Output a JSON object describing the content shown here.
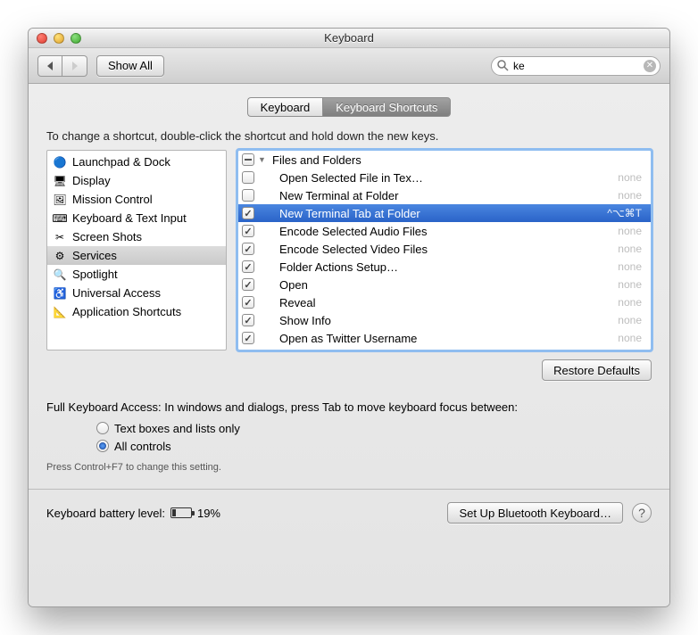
{
  "window": {
    "title": "Keyboard"
  },
  "toolbar": {
    "show_all": "Show All",
    "search_value": "ke"
  },
  "tabs": {
    "keyboard": "Keyboard",
    "shortcuts": "Keyboard Shortcuts"
  },
  "instructions": "To change a shortcut, double-click the shortcut and hold down the new keys.",
  "sidebar": {
    "items": [
      {
        "label": "Launchpad & Dock",
        "icon": "🔵",
        "selected": false
      },
      {
        "label": "Display",
        "icon": "🖥",
        "selected": false
      },
      {
        "label": "Mission Control",
        "icon": "🖼",
        "selected": false
      },
      {
        "label": "Keyboard & Text Input",
        "icon": "⌨",
        "selected": false
      },
      {
        "label": "Screen Shots",
        "icon": "✂",
        "selected": false
      },
      {
        "label": "Services",
        "icon": "⚙",
        "selected": true
      },
      {
        "label": "Spotlight",
        "icon": "🔍",
        "selected": false
      },
      {
        "label": "Universal Access",
        "icon": "♿",
        "selected": false
      },
      {
        "label": "Application Shortcuts",
        "icon": "📐",
        "selected": false
      }
    ]
  },
  "shortcuts": {
    "group": "Files and Folders",
    "rows": [
      {
        "checked": false,
        "label": "Open Selected File in Tex…",
        "key": "none",
        "selected": false
      },
      {
        "checked": false,
        "label": "New Terminal at Folder",
        "key": "none",
        "selected": false
      },
      {
        "checked": true,
        "label": "New Terminal Tab at Folder",
        "key": "^⌥⌘T",
        "selected": true
      },
      {
        "checked": true,
        "label": "Encode Selected Audio Files",
        "key": "none",
        "selected": false
      },
      {
        "checked": true,
        "label": "Encode Selected Video Files",
        "key": "none",
        "selected": false
      },
      {
        "checked": true,
        "label": "Folder Actions Setup…",
        "key": "none",
        "selected": false
      },
      {
        "checked": true,
        "label": "Open",
        "key": "none",
        "selected": false
      },
      {
        "checked": true,
        "label": "Reveal",
        "key": "none",
        "selected": false
      },
      {
        "checked": true,
        "label": "Show Info",
        "key": "none",
        "selected": false
      },
      {
        "checked": true,
        "label": "Open as Twitter Username",
        "key": "none",
        "selected": false
      }
    ]
  },
  "restore_defaults": "Restore Defaults",
  "access": {
    "label": "Full Keyboard Access: In windows and dialogs, press Tab to move keyboard focus between:",
    "opt1": "Text boxes and lists only",
    "opt2": "All controls",
    "hint": "Press Control+F7 to change this setting."
  },
  "footer": {
    "battery_label": "Keyboard battery level:",
    "battery_pct": "19%",
    "bluetooth": "Set Up Bluetooth Keyboard…"
  }
}
